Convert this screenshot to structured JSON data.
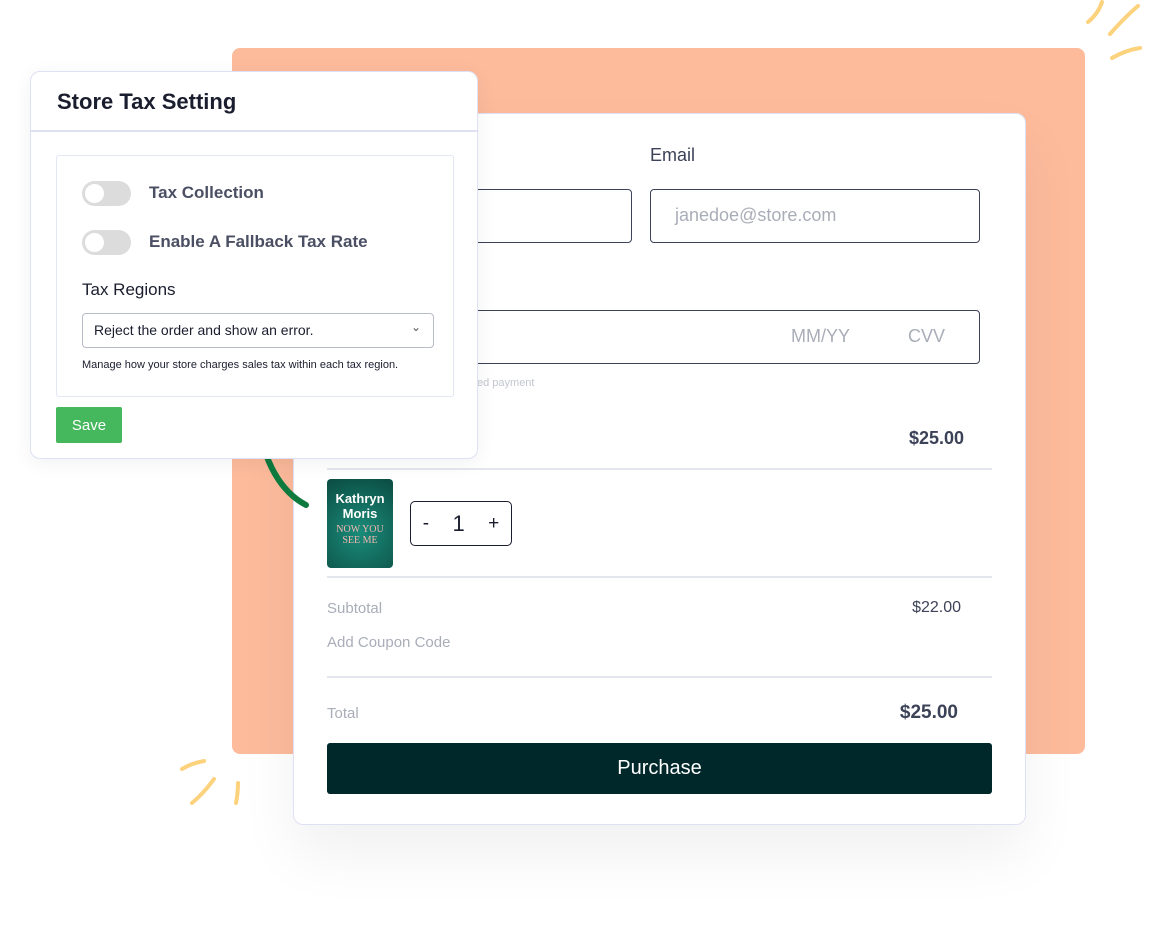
{
  "colors": {
    "accent_bg": "#fdbb9c",
    "save": "#45b75c",
    "purchase": "#00282a",
    "arrow": "#0d7a3e",
    "sparkle": "#fcd27d"
  },
  "checkout": {
    "email_label": "Email",
    "email_placeholder": "janedoe@store.com",
    "expiry_placeholder": "MM/YY",
    "cvv_placeholder": "CVV",
    "payment_note": "ed payment",
    "header_price": "$25.00",
    "product": {
      "cover_author": "Kathryn Moris",
      "cover_title": "NOW YOU SEE ME",
      "quantity": "1",
      "minus": "-",
      "plus": "+"
    },
    "subtotal_label": "Subtotal",
    "subtotal_value": "$22.00",
    "coupon_label": "Add Coupon Code",
    "total_label": "Total",
    "total_value": "$25.00",
    "purchase_label": "Purchase"
  },
  "tax_panel": {
    "title": "Store Tax Setting",
    "toggles": [
      {
        "label": "Tax Collection",
        "on": false
      },
      {
        "label": "Enable A Fallback Tax Rate",
        "on": false
      }
    ],
    "regions_label": "Tax Regions",
    "regions_value": "Reject the order and show an error.",
    "help": "Manage how your store charges sales tax within each tax region.",
    "save_label": "Save"
  }
}
